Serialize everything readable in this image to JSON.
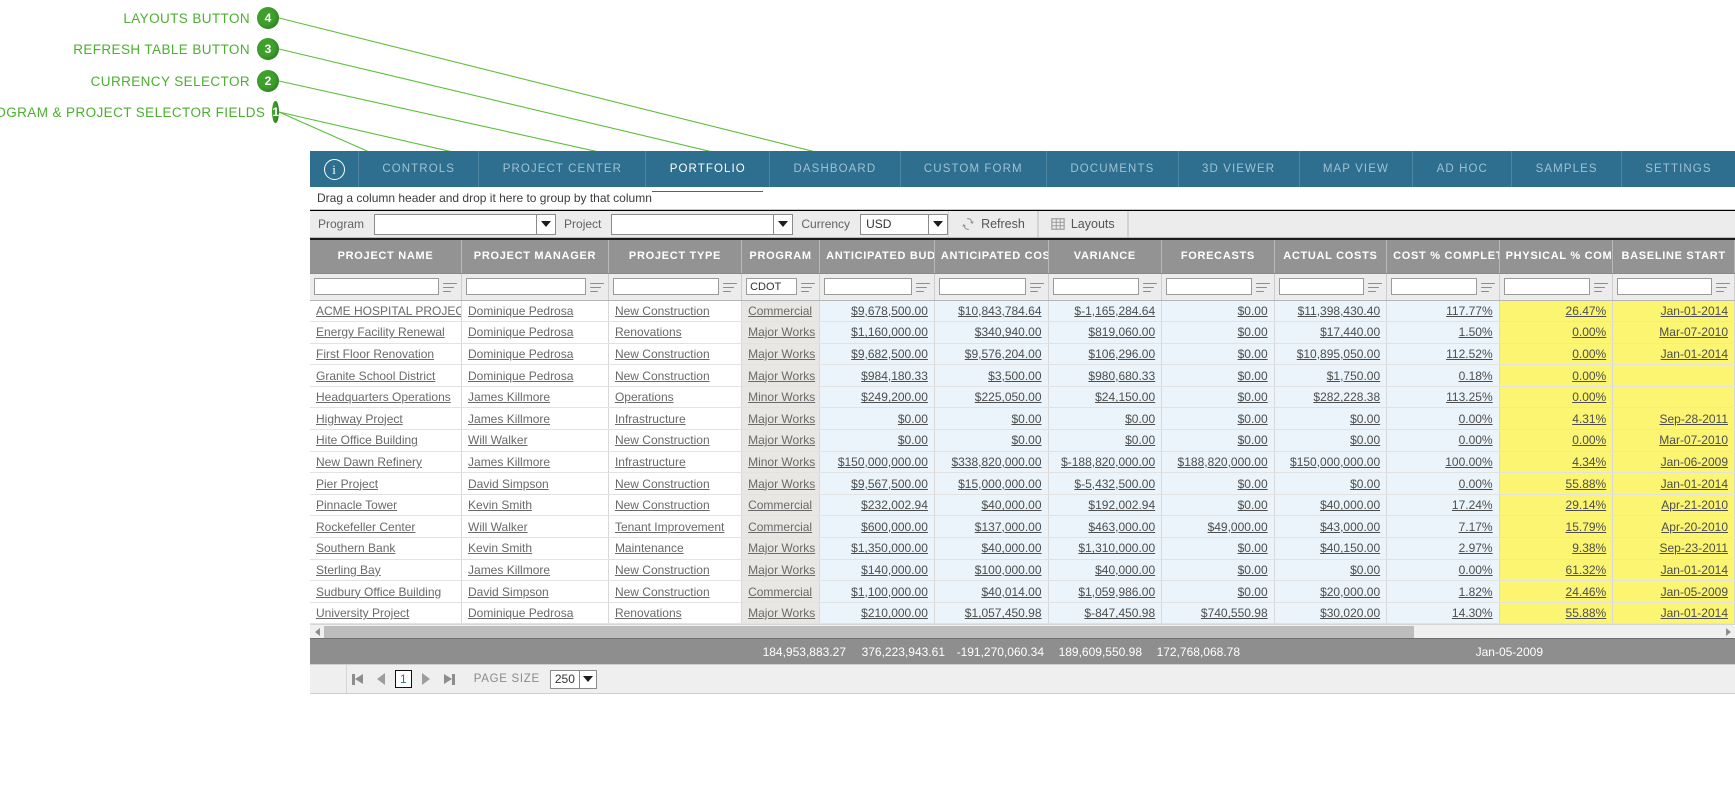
{
  "annotations": [
    {
      "num": "4",
      "label": "LAYOUTS BUTTON"
    },
    {
      "num": "3",
      "label": "REFRESH TABLE BUTTON"
    },
    {
      "num": "2",
      "label": "CURRENCY SELECTOR"
    },
    {
      "num": "1",
      "label": "PROGRAM & PROJECT SELECTOR FIELDS"
    }
  ],
  "tabs": [
    {
      "label": "CONTROLS",
      "active": false
    },
    {
      "label": "PROJECT CENTER",
      "active": false
    },
    {
      "label": "PORTFOLIO",
      "active": true
    },
    {
      "label": "DASHBOARD",
      "active": false
    },
    {
      "label": "CUSTOM FORM",
      "active": false
    },
    {
      "label": "DOCUMENTS",
      "active": false
    },
    {
      "label": "3D VIEWER",
      "active": false
    },
    {
      "label": "MAP VIEW",
      "active": false
    },
    {
      "label": "AD HOC",
      "active": false
    },
    {
      "label": "SAMPLES",
      "active": false
    },
    {
      "label": "SETTINGS",
      "active": false
    }
  ],
  "group_bar": {
    "text": "Drag a column header and drop it here to group by that column"
  },
  "toolbar": {
    "program_label": "Program",
    "program_value": "",
    "project_label": "Project",
    "project_value": "",
    "currency_label": "Currency",
    "currency_value": "USD",
    "refresh_label": "Refresh",
    "layouts_label": "Layouts"
  },
  "grid": {
    "columns": [
      {
        "header": "PROJECT NAME",
        "kind": "text",
        "filter": ""
      },
      {
        "header": "PROJECT MANAGER",
        "kind": "text",
        "filter": ""
      },
      {
        "header": "PROJECT TYPE",
        "kind": "text",
        "filter": ""
      },
      {
        "header": "PROGRAM",
        "kind": "prog",
        "filter": "CDOT"
      },
      {
        "header": "ANTICIPATED BUDGET",
        "kind": "num",
        "filter": ""
      },
      {
        "header": "ANTICIPATED COST",
        "kind": "num",
        "filter": ""
      },
      {
        "header": "VARIANCE",
        "kind": "num",
        "filter": ""
      },
      {
        "header": "FORECASTS",
        "kind": "num",
        "filter": ""
      },
      {
        "header": "ACTUAL COSTS",
        "kind": "num",
        "filter": ""
      },
      {
        "header": "COST % COMPLETE",
        "kind": "num",
        "filter": ""
      },
      {
        "header": "PHYSICAL % COMPLETE",
        "kind": "yel",
        "filter": ""
      },
      {
        "header": "BASELINE START",
        "kind": "yel",
        "filter": ""
      }
    ],
    "rows": [
      [
        "ACME HOSPITAL PROJECT",
        "Dominique Pedrosa",
        "New Construction",
        "Commercial",
        "$9,678,500.00",
        "$10,843,784.64",
        "$-1,165,284.64",
        "$0.00",
        "$11,398,430.40",
        "117.77%",
        "26.47%",
        "Jan-01-2014"
      ],
      [
        "Energy Facility Renewal",
        "Dominique Pedrosa",
        "Renovations",
        "Major Works",
        "$1,160,000.00",
        "$340,940.00",
        "$819,060.00",
        "$0.00",
        "$17,440.00",
        "1.50%",
        "0.00%",
        "Mar-07-2010"
      ],
      [
        "First Floor Renovation",
        "Dominique Pedrosa",
        "New Construction",
        "Major Works",
        "$9,682,500.00",
        "$9,576,204.00",
        "$106,296.00",
        "$0.00",
        "$10,895,050.00",
        "112.52%",
        "0.00%",
        "Jan-01-2014"
      ],
      [
        "Granite School District",
        "Dominique Pedrosa",
        "New Construction",
        "Major Works",
        "$984,180.33",
        "$3,500.00",
        "$980,680.33",
        "$0.00",
        "$1,750.00",
        "0.18%",
        "0.00%",
        ""
      ],
      [
        "Headquarters Operations",
        "James Killmore",
        "Operations",
        "Minor Works",
        "$249,200.00",
        "$225,050.00",
        "$24,150.00",
        "$0.00",
        "$282,228.38",
        "113.25%",
        "0.00%",
        ""
      ],
      [
        "Highway Project",
        "James Killmore",
        "Infrastructure",
        "Major Works",
        "$0.00",
        "$0.00",
        "$0.00",
        "$0.00",
        "$0.00",
        "0.00%",
        "4.31%",
        "Sep-28-2011"
      ],
      [
        "Hite Office Building",
        "Will Walker",
        "New Construction",
        "Major Works",
        "$0.00",
        "$0.00",
        "$0.00",
        "$0.00",
        "$0.00",
        "0.00%",
        "0.00%",
        "Mar-07-2010"
      ],
      [
        "New Dawn Refinery",
        "James Killmore",
        "Infrastructure",
        "Minor Works",
        "$150,000,000.00",
        "$338,820,000.00",
        "$-188,820,000.00",
        "$188,820,000.00",
        "$150,000,000.00",
        "100.00%",
        "4.34%",
        "Jan-06-2009"
      ],
      [
        "Pier Project",
        "David Simpson",
        "New Construction",
        "Major Works",
        "$9,567,500.00",
        "$15,000,000.00",
        "$-5,432,500.00",
        "$0.00",
        "$0.00",
        "0.00%",
        "55.88%",
        "Jan-01-2014"
      ],
      [
        "Pinnacle Tower",
        "Kevin Smith",
        "New Construction",
        "Commercial",
        "$232,002.94",
        "$40,000.00",
        "$192,002.94",
        "$0.00",
        "$40,000.00",
        "17.24%",
        "29.14%",
        "Apr-21-2010"
      ],
      [
        "Rockefeller Center",
        "Will Walker",
        "Tenant Improvement",
        "Commercial",
        "$600,000.00",
        "$137,000.00",
        "$463,000.00",
        "$49,000.00",
        "$43,000.00",
        "7.17%",
        "15.79%",
        "Apr-20-2010"
      ],
      [
        "Southern Bank",
        "Kevin Smith",
        "Maintenance",
        "Major Works",
        "$1,350,000.00",
        "$40,000.00",
        "$1,310,000.00",
        "$0.00",
        "$40,150.00",
        "2.97%",
        "9.38%",
        "Sep-23-2011"
      ],
      [
        "Sterling Bay",
        "James Killmore",
        "New Construction",
        "Major Works",
        "$140,000.00",
        "$100,000.00",
        "$40,000.00",
        "$0.00",
        "$0.00",
        "0.00%",
        "61.32%",
        "Jan-01-2014"
      ],
      [
        "Sudbury Office Building",
        "David Simpson",
        "New Construction",
        "Commercial",
        "$1,100,000.00",
        "$40,014.00",
        "$1,059,986.00",
        "$0.00",
        "$20,000.00",
        "1.82%",
        "24.46%",
        "Jan-05-2009"
      ],
      [
        "University Project",
        "Dominique Pedrosa",
        "Renovations",
        "Major Works",
        "$210,000.00",
        "$1,057,450.98",
        "$-847,450.98",
        "$740,550.98",
        "$30,020.00",
        "14.30%",
        "55.88%",
        "Jan-01-2014"
      ]
    ],
    "summary": {
      "anticipated_budget": "184,953,883.27",
      "anticipated_cost": "376,223,943.61",
      "variance": "-191,270,060.34",
      "forecasts": "189,609,550.98",
      "actual_costs": "172,768,068.78",
      "baseline_start": "Jan-05-2009"
    }
  },
  "pager": {
    "page": "1",
    "page_size_label": "PAGE SIZE",
    "page_size_value": "250"
  }
}
